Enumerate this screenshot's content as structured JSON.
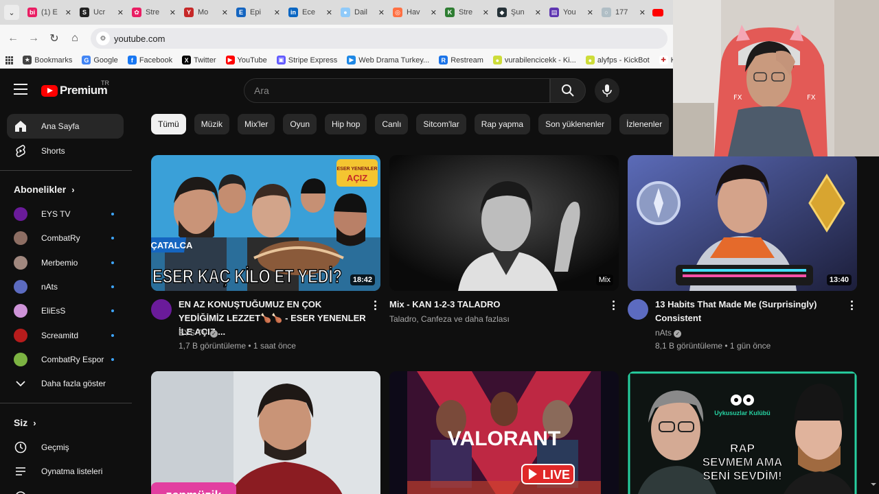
{
  "browser": {
    "tabs": [
      {
        "title": "(1) E",
        "color": "#e91e63",
        "glyph": "bi"
      },
      {
        "title": "Ucr",
        "color": "#222222",
        "glyph": "S"
      },
      {
        "title": "Stre",
        "color": "#e91e63",
        "glyph": "✿"
      },
      {
        "title": "Mo",
        "color": "#c62828",
        "glyph": "Y"
      },
      {
        "title": "Epi",
        "color": "#1565c0",
        "glyph": "E"
      },
      {
        "title": "Ece",
        "color": "#0a66c2",
        "glyph": "in"
      },
      {
        "title": "Dail",
        "color": "#90caf9",
        "glyph": "●"
      },
      {
        "title": "Hav",
        "color": "#ff7043",
        "glyph": "◎"
      },
      {
        "title": "Stre",
        "color": "#2e7d32",
        "glyph": "K"
      },
      {
        "title": "Şun",
        "color": "#263238",
        "glyph": "◆"
      },
      {
        "title": "You",
        "color": "#5e35b1",
        "glyph": "▤"
      },
      {
        "title": "177",
        "color": "#b0bec5",
        "glyph": "○"
      }
    ],
    "url": "youtube.com",
    "bookmarks": [
      {
        "label": "Bookmarks",
        "color": "#444444",
        "glyph": "★"
      },
      {
        "label": "Google",
        "color": "#4285f4",
        "glyph": "G"
      },
      {
        "label": "Facebook",
        "color": "#1877f2",
        "glyph": "f"
      },
      {
        "label": "Twitter",
        "color": "#000000",
        "glyph": "X"
      },
      {
        "label": "YouTube",
        "color": "#ff0000",
        "glyph": "▶"
      },
      {
        "label": "Stripe Express",
        "color": "#635bff",
        "glyph": "▣"
      },
      {
        "label": "Web Drama Turkey...",
        "color": "#1e88e5",
        "glyph": "▶"
      },
      {
        "label": "Restream",
        "color": "#1a73e8",
        "glyph": "R"
      },
      {
        "label": "vurabilencicekk - Ki...",
        "color": "#cddc39",
        "glyph": "●"
      },
      {
        "label": "alyfps - KickBot",
        "color": "#cddc39",
        "glyph": "●"
      },
      {
        "label": "Korean Vi",
        "color": "#ffffff",
        "glyph": "✚"
      }
    ]
  },
  "header": {
    "logo_text": "Premium",
    "region": "TR",
    "search_placeholder": "Ara"
  },
  "chips": [
    "Tümü",
    "Müzik",
    "Mix'ler",
    "Oyun",
    "Hip hop",
    "Canlı",
    "Sitcom'lar",
    "Rap yapma",
    "Son yüklenenler",
    "İzlenenler"
  ],
  "sidebar": {
    "main": [
      {
        "label": "Ana Sayfa",
        "icon": "home-icon"
      },
      {
        "label": "Shorts",
        "icon": "shorts-icon"
      }
    ],
    "subscriptions_title": "Abonelikler",
    "subscriptions": [
      {
        "label": "EYS TV",
        "color": "#6a1b9a"
      },
      {
        "label": "CombatRy",
        "color": "#8d6e63"
      },
      {
        "label": "Merbemio",
        "color": "#a1887f"
      },
      {
        "label": "nAts",
        "color": "#5c6bc0"
      },
      {
        "label": "EliEsS",
        "color": "#ce93d8"
      },
      {
        "label": "Screamitd",
        "color": "#b71c1c"
      },
      {
        "label": "CombatRy Espor",
        "color": "#7cb342"
      }
    ],
    "show_more": "Daha fazla göster",
    "you_title": "Siz",
    "you_items": [
      {
        "label": "Geçmiş",
        "icon": "history-icon"
      },
      {
        "label": "Oynatma listeleri",
        "icon": "playlist-icon"
      }
    ]
  },
  "videos": [
    {
      "title": "EN AZ KONUŞTUĞUMUZ EN ÇOK YEDİĞİMİZ LEZZET🍗🍗 - ESER YENENLER İLE AÇIZ ...",
      "channel": "EYS TV",
      "verified": true,
      "meta": "1,7 B görüntüleme • 1 saat önce",
      "duration": "18:42",
      "thumb_text": "ESER KAÇ KİLO ET YEDİ?",
      "thumb_tag": "ÇATALCA"
    },
    {
      "title": "Mix - KAN 1-2-3 TALADRO",
      "channel": "Taladro, Canfeza ve daha fazlası",
      "verified": false,
      "meta": "",
      "duration": "Mix",
      "thumb_text": "",
      "thumb_tag": ""
    },
    {
      "title": "13 Habits That Made Me (Surprisingly) Consistent",
      "channel": "nAts",
      "verified": true,
      "meta": "8,1 B görüntüleme • 1 gün önce",
      "duration": "13:40",
      "thumb_text": "",
      "thumb_tag": ""
    },
    {
      "title": "",
      "channel": "",
      "verified": false,
      "meta": "",
      "duration": "",
      "thumb_text": "zenmüzik",
      "thumb_tag": ""
    },
    {
      "title": "",
      "channel": "",
      "verified": false,
      "meta": "",
      "duration": "",
      "thumb_text": "VALORANT",
      "thumb_tag": "LIVE"
    },
    {
      "title": "",
      "channel": "",
      "verified": false,
      "meta": "",
      "duration": "",
      "thumb_text": "RAP SEVMEM AMA SENİ SEVDİM!",
      "thumb_tag": "Uykusuzlar Kulübü"
    }
  ]
}
